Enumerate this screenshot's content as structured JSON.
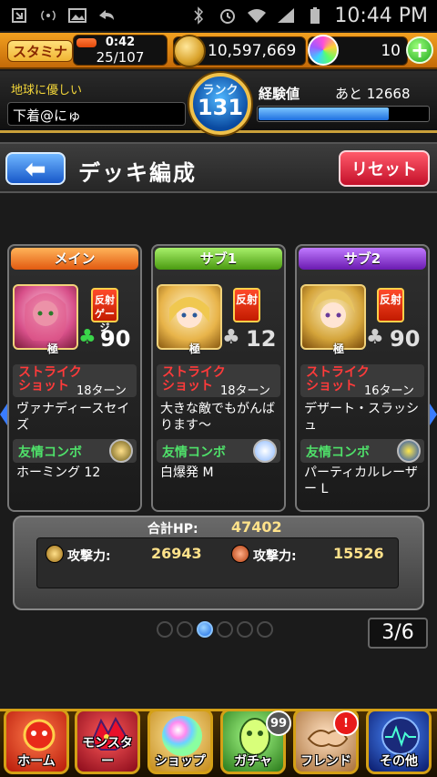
{
  "statusbar": {
    "time": "10:44 PM"
  },
  "resources": {
    "stamina_label": "スタミナ",
    "stamina_timer": "0:42",
    "stamina_value": "25/107",
    "stamina_fraction": 0.23,
    "gold": "10,597,669",
    "orbs": "10",
    "plus_label": "+"
  },
  "player": {
    "title": "地球に優しい",
    "name": "下着@にゅ",
    "rank_label": "ランク",
    "rank": "131",
    "exp_label": "経験値",
    "exp_remaining": "あと 12668",
    "exp_fraction": 0.77
  },
  "header": {
    "back_label": "⬅",
    "title": "デッキ編成",
    "reset_label": "リセット"
  },
  "cards": [
    {
      "tab": "メイン",
      "tab_color": "#ff7a1a",
      "counter": "反射ゲージ",
      "ex": "極",
      "luck": "90",
      "ss_label": "ストライク\nショット",
      "ss_turns": "18ターン",
      "ss_name": "ヴァナディースセイズ",
      "fc_label": "友情コンボ",
      "fc_name": "ホーミング 12"
    },
    {
      "tab": "サブ1",
      "tab_color": "#7ad62a",
      "counter": "反射",
      "ex": "極",
      "luck": "12",
      "ss_label": "ストライク\nショット",
      "ss_turns": "18ターン",
      "ss_name": "大きな敵でもがんばります〜",
      "fc_label": "友情コンボ",
      "fc_name": "白爆発 M"
    },
    {
      "tab": "サブ2",
      "tab_color": "#8a3ad6",
      "counter": "反射",
      "ex": "極",
      "luck": "90",
      "ss_label": "ストライク\nショット",
      "ss_turns": "16ターン",
      "ss_name": "デザート・スラッシュ",
      "fc_label": "友情コンボ",
      "fc_name": "パーティカルレーザー L"
    }
  ],
  "stats": {
    "hp_label": "合計HP:",
    "hp": "47402",
    "atk1_label": "攻撃力:",
    "atk1": "26943",
    "atk2_label": "攻撃力:",
    "atk2": "15526"
  },
  "pager": {
    "indicator": "3/6",
    "active_dot": 3,
    "dot_count": 6
  },
  "nav": [
    {
      "label": "ホーム",
      "icon": "home-icon"
    },
    {
      "label": "モンスター",
      "icon": "monster-icon"
    },
    {
      "label": "ショップ",
      "icon": "shop-icon"
    },
    {
      "label": "ガチャ",
      "icon": "gacha-icon",
      "badge": "99"
    },
    {
      "label": "フレンド",
      "icon": "friend-icon",
      "badge": "!"
    },
    {
      "label": "その他",
      "icon": "other-icon"
    }
  ]
}
